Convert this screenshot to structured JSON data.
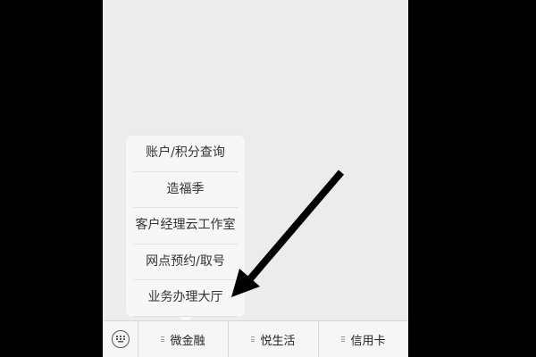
{
  "popup_menu": {
    "items": [
      {
        "label": "账户/积分查询"
      },
      {
        "label": "造福季"
      },
      {
        "label": "客户经理云工作室"
      },
      {
        "label": "网点预约/取号"
      },
      {
        "label": "业务办理大厅"
      }
    ]
  },
  "bottom_bar": {
    "keyboard_icon": "keyboard-icon",
    "tabs": [
      {
        "label": "微金融"
      },
      {
        "label": "悦生活"
      },
      {
        "label": "信用卡"
      }
    ]
  },
  "annotation": {
    "arrow_icon": "arrow-icon",
    "color": "#000000"
  }
}
